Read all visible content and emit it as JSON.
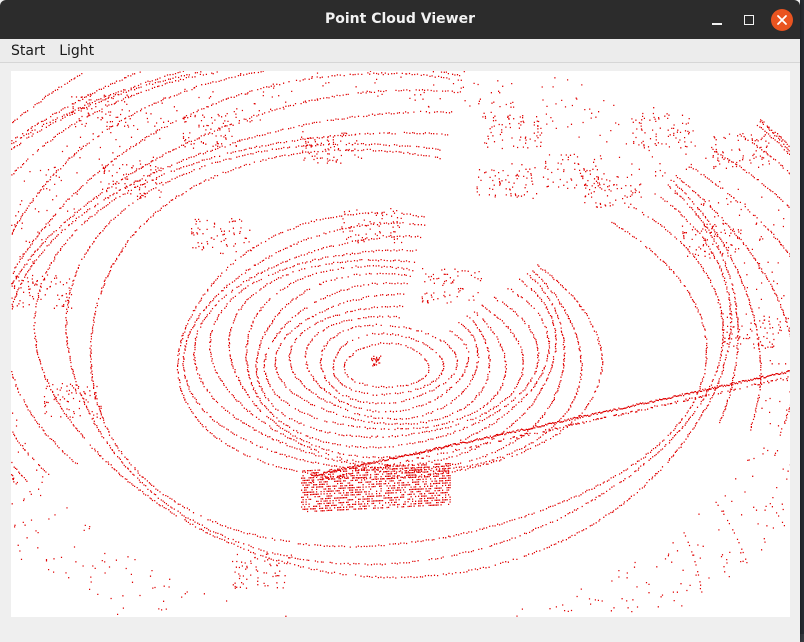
{
  "window": {
    "title": "Point Cloud Viewer"
  },
  "menu": {
    "items": [
      "Start",
      "Light"
    ]
  },
  "window_controls": {
    "minimize": "minimize-icon",
    "maximize": "maximize-icon",
    "close": "close-icon"
  },
  "colors": {
    "point": "#e00000",
    "titlebar": "#2c2c2c",
    "close": "#e95420",
    "viewport": "#ffffff"
  }
}
